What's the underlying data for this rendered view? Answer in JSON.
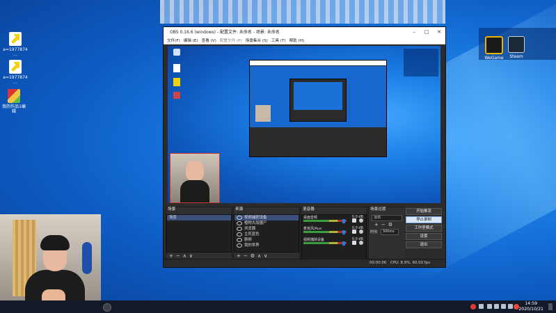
{
  "desktop": {
    "icons": [
      {
        "label": "a=1977874 ..."
      },
      {
        "label": "a=1977874 ..."
      },
      {
        "label": "我的作品1编 辑"
      }
    ],
    "tray_apps": [
      {
        "label": "WeGame"
      },
      {
        "label": "Steam"
      }
    ]
  },
  "obs": {
    "title": "OBS 0.16.6 (windows) - 配置文件: 未命名 - 场景: 未命名",
    "menu": [
      "文件(F)",
      "编辑 (E)",
      "查看 (V)",
      "配置文件 (P)",
      "场景集合 (S)",
      "工具 (T)",
      "帮助 (H)"
    ],
    "docks": {
      "scenes": {
        "title": "场景",
        "items": [
          "场景"
        ]
      },
      "sources": {
        "title": "来源",
        "items": [
          "视频捕获设备",
          "植物大战僵尸",
          "浏览器",
          "主死蓝色",
          "剧频",
          "我的世界",
          "..."
        ]
      },
      "mixer": {
        "title": "混音器",
        "items": [
          {
            "name": "桌面音频",
            "db": "0.0 dB"
          },
          {
            "name": "麦克风/Aux",
            "db": "0.0 dB"
          },
          {
            "name": "视频捕获设备",
            "db": "0.0 dB"
          }
        ]
      },
      "transitions": {
        "title": "场景过渡",
        "type": "淡出",
        "duration_label": "时长",
        "duration": "300ms"
      },
      "controls": {
        "title": "控件",
        "buttons": [
          "开始推流",
          "停止录制",
          "工作室模式",
          "设置",
          "退出"
        ]
      }
    },
    "status": {
      "time": "00:00:06",
      "cpu": "CPU: 8.9%, 60.00 fps"
    }
  },
  "taskbar": {
    "time": "14:59",
    "date": "2020/10/21"
  },
  "colors": {
    "desktop_blue": "#1b7fe6",
    "obs_dark": "#2b2b2b",
    "taskbar": "#121a2a",
    "active_button": "#d8e6f8"
  }
}
